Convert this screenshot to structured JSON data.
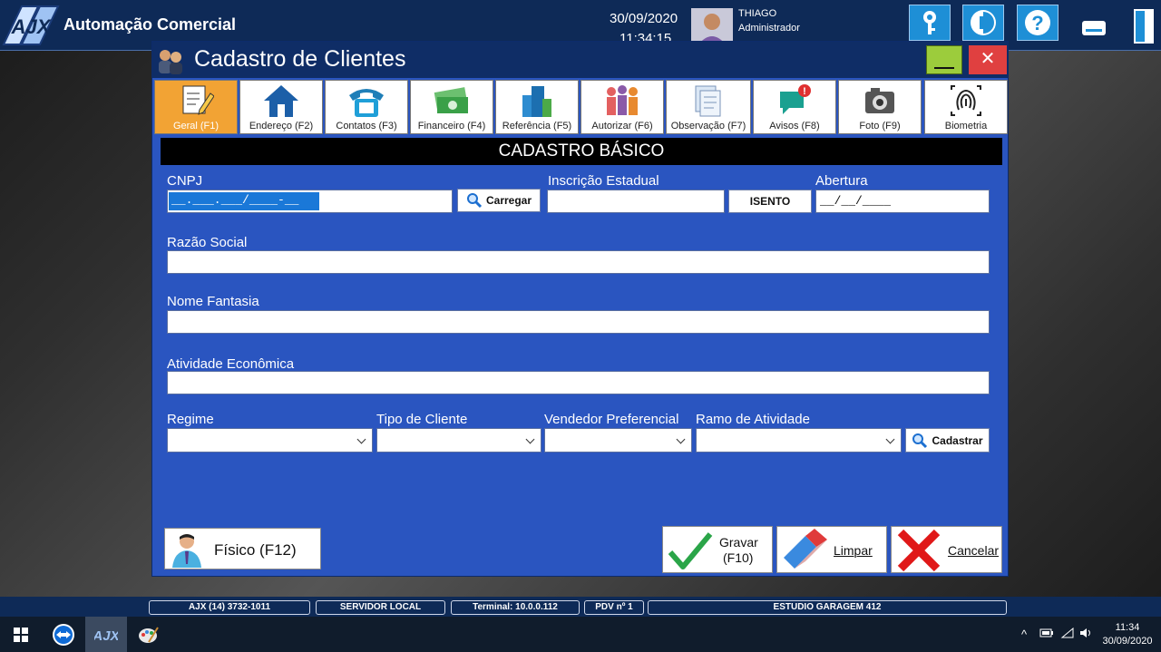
{
  "app": {
    "title": "Automação Comercial",
    "date": "30/09/2020",
    "time": "11:34:15",
    "user_name": "THIAGO",
    "user_role": "Administrador",
    "logo_text": "AJX"
  },
  "top_buttons": [
    {
      "icon": "key-icon"
    },
    {
      "icon": "support-icon"
    },
    {
      "icon": "help-icon"
    },
    {
      "icon": "minimize-icon"
    },
    {
      "icon": "exit-door-icon"
    }
  ],
  "dialog": {
    "title": "Cadastro de Clientes",
    "close_label": "✕",
    "tabs": [
      {
        "label": "Geral (F1)",
        "icon": "document-pencil-icon",
        "active": true
      },
      {
        "label": "Endereço (F2)",
        "icon": "house-icon"
      },
      {
        "label": "Contatos (F3)",
        "icon": "telephone-icon"
      },
      {
        "label": "Financeiro (F4)",
        "icon": "money-icon"
      },
      {
        "label": "Referência (F5)",
        "icon": "buildings-icon"
      },
      {
        "label": "Autorizar (F6)",
        "icon": "people-icon"
      },
      {
        "label": "Observação (F7)",
        "icon": "notes-icon"
      },
      {
        "label": "Avisos (F8)",
        "icon": "alert-chat-icon"
      },
      {
        "label": "Foto (F9)",
        "icon": "camera-icon"
      },
      {
        "label": "Biometria",
        "icon": "fingerprint-icon"
      }
    ],
    "section_title": "CADASTRO BÁSICO",
    "form": {
      "cnpj_label": "CNPJ",
      "cnpj_value": "__.___.___/____-__",
      "load_button": "Carregar",
      "ie_label": "Inscrição Estadual",
      "ie_value": "",
      "isento_button": "ISENTO",
      "abertura_label": "Abertura",
      "abertura_value": "__/__/____",
      "razao_label": "Razão Social",
      "razao_value": "",
      "fantasia_label": "Nome Fantasia",
      "fantasia_value": "",
      "atividade_label": "Atividade Econômica",
      "atividade_value": "",
      "regime_label": "Regime",
      "tipo_label": "Tipo de Cliente",
      "vendedor_label": "Vendedor Preferencial",
      "ramo_label": "Ramo de Atividade",
      "cadastrar_button": "Cadastrar"
    },
    "buttons": {
      "fisico": "Físico (F12)",
      "gravar_line1": "Gravar",
      "gravar_line2": "(F10)",
      "limpar": "Limpar",
      "cancelar": "Cancelar"
    }
  },
  "statusbar": {
    "phone": "AJX (14) 3732-1011",
    "server": "SERVIDOR LOCAL",
    "terminal": "Terminal: 10.0.0.112",
    "pdv": "PDV nº 1",
    "company": "ESTUDIO GARAGEM 412"
  },
  "taskbar": {
    "clock_time": "11:34",
    "clock_date": "30/09/2020",
    "tray_chevron": "^"
  }
}
